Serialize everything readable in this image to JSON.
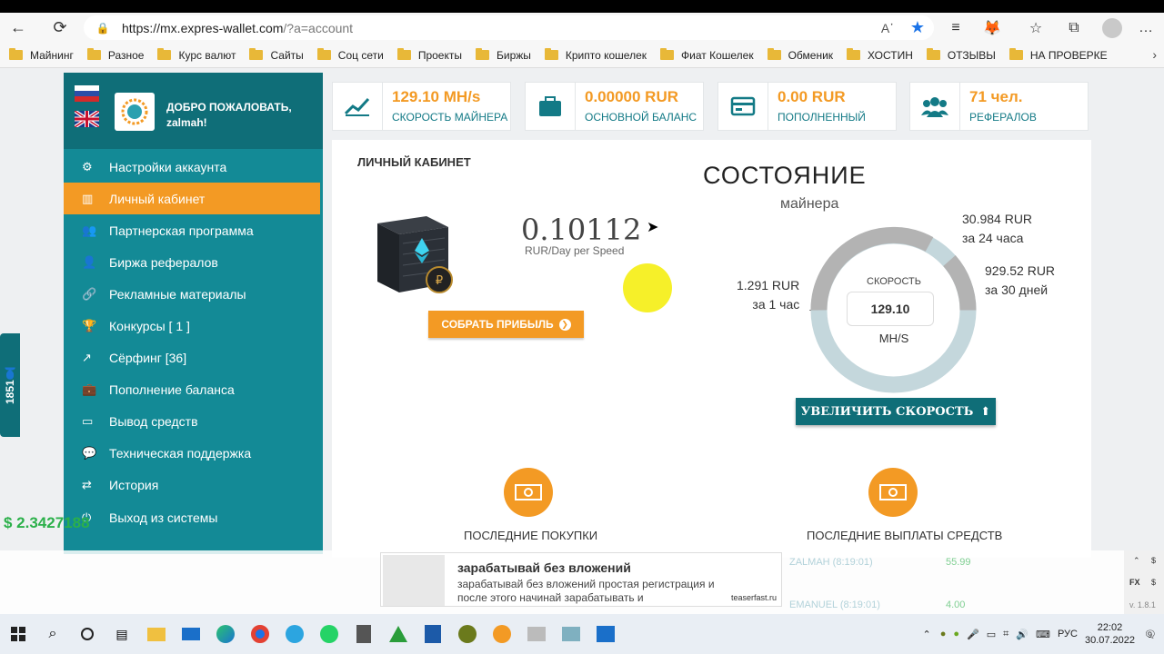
{
  "browser": {
    "url_host": "https://mx.expres-wallet.com",
    "url_rest": "/?a=account"
  },
  "bookmarks": [
    "Майнинг",
    "Разное",
    "Курс валют",
    "Сайты",
    "Соц сети",
    "Проекты",
    "Биржы",
    "Крипто кошелек",
    "Фиат Кошелек",
    "Обменик",
    "ХОСТИН",
    "ОТЗЫВЫ",
    "НА ПРОВЕРКЕ"
  ],
  "sidebar": {
    "welcome_line1": "ДОБРО ПОЖАЛОВАТЬ,",
    "welcome_line2": "zalmah!",
    "items": [
      {
        "label": "Настройки аккаунта",
        "icon": "⚙"
      },
      {
        "label": "Личный кабинет",
        "icon": "▥"
      },
      {
        "label": "Партнерская программа",
        "icon": "👥"
      },
      {
        "label": "Биржа рефералов",
        "icon": "👤"
      },
      {
        "label": "Рекламные материалы",
        "icon": "🔗"
      },
      {
        "label": "Конкурсы [ 1 ]",
        "icon": "🏆"
      },
      {
        "label": "Сёрфинг [36]",
        "icon": "↗"
      },
      {
        "label": "Пополнение баланса",
        "icon": "💼"
      },
      {
        "label": "Вывод средств",
        "icon": "▭"
      },
      {
        "label": "Техническая поддержка",
        "icon": "💬"
      },
      {
        "label": "История",
        "icon": "⇄"
      },
      {
        "label": "Выход из системы",
        "icon": "⏻"
      }
    ],
    "online_count": "1851"
  },
  "stats": [
    {
      "value": "129.10 MH/s",
      "label": "СКОРОСТЬ МАЙНЕРА",
      "icon": "chart-icon"
    },
    {
      "value": "0.00000 RUR",
      "label": "ОСНОВНОЙ БАЛАНС",
      "icon": "briefcase-icon"
    },
    {
      "value": "0.00 RUR",
      "label": "ПОПОЛНЕННЫЙ",
      "icon": "card-icon"
    },
    {
      "value": "71 чел.",
      "label": "РЕФЕРАЛОВ",
      "icon": "users-icon"
    }
  ],
  "cabinet": {
    "title": "ЛИЧНЫЙ КАБИНЕТ",
    "rate": "0.10112",
    "rate_unit": "RUR/Day per Speed",
    "collect_label": "СОБРАТЬ ПРИБЫЛЬ"
  },
  "state": {
    "title": "СОСТОЯНИЕ",
    "subtitle": "майнера",
    "speed_label": "СКОРОСТЬ",
    "speed_value": "129.10",
    "speed_unit": "MH/S",
    "hour_value": "1.291 RUR",
    "hour_label": "за 1 час",
    "day_value": "30.984 RUR",
    "day_label": "за 24 часа",
    "month_value": "929.52 RUR",
    "month_label": "за 30 дней",
    "increase_label": "УВЕЛИЧИТЬ СКОРОСТЬ"
  },
  "sections": {
    "purchases": "ПОСЛЕДНИЕ ПОКУПКИ",
    "payouts": "ПОСЛЕДНИЕ ВЫПЛАТЫ СРЕДСТВ"
  },
  "overlay": {
    "balance": "$ 2.3427188",
    "ad_title": "зарабатывай без вложений",
    "ad_text": "зарабатывай без вложений простая регистрация и после этого начинай зарабатывать и",
    "ad_source": "teaserfast.ru",
    "blur_row1": "ZALMAH (8:19:01)",
    "blur_amt1": "55.99",
    "blur_row2": "EMANUEL (8:19:01)",
    "blur_amt2": "4.00",
    "fx_label": "FX",
    "version": "v. 1.8.1"
  },
  "taskbar": {
    "lang": "РУС",
    "time": "22:02",
    "date": "30.07.2022",
    "notif": "9"
  },
  "colors": {
    "teal": "#138a96",
    "orange": "#f39a24",
    "dark_teal": "#0f6e78"
  }
}
